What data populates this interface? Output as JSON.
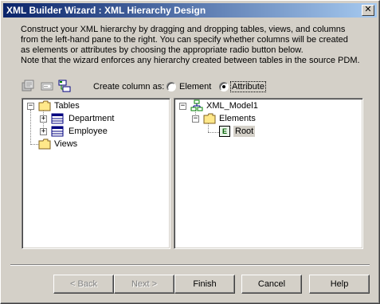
{
  "window": {
    "title": "XML Builder Wizard : XML Hierarchy Design",
    "close_glyph": "✕"
  },
  "intro": {
    "text": "Construct your XML hierarchy by dragging and dropping tables, views, and columns\nfrom the left-hand pane to the right. You can specify whether columns  will be created\nas elements or attributes by choosing the appropriate radio button below.\nNote that the wizard enforces any hierarchy created between tables in the source PDM."
  },
  "toolbar": {
    "icons": [
      "properties-icon",
      "rename-icon",
      "add-element-icon"
    ]
  },
  "create_column": {
    "label": "Create column as:",
    "options": [
      {
        "label": "Element",
        "selected": false
      },
      {
        "label": "Attribute",
        "selected": true
      }
    ]
  },
  "left_tree": {
    "root": "Tables",
    "tables": [
      "Department",
      "Employee"
    ],
    "views": "Views"
  },
  "right_tree": {
    "model": "XML_Model1",
    "elements_folder": "Elements",
    "root_element": "Root",
    "element_badge": "E"
  },
  "buttons": {
    "back": "< Back",
    "next": "Next >",
    "finish": "Finish",
    "cancel": "Cancel",
    "help": "Help"
  }
}
